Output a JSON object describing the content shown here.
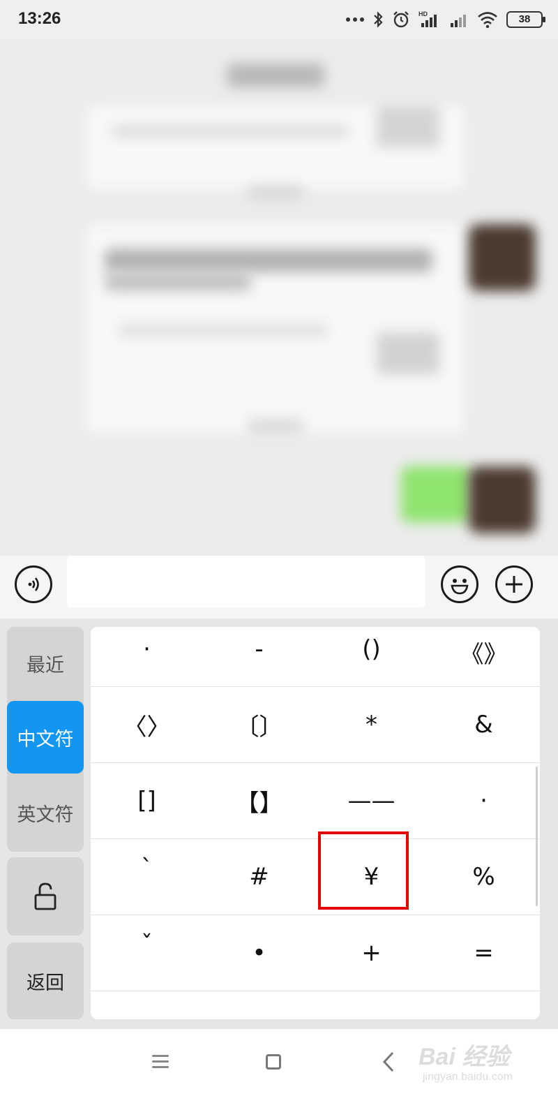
{
  "status_bar": {
    "time": "13:26",
    "battery": "38",
    "icons": [
      "more-dots-icon",
      "bluetooth-icon",
      "alarm-icon",
      "hd-signal-icon",
      "signal-icon",
      "wifi-icon",
      "battery-icon"
    ]
  },
  "input_bar": {
    "voice_icon": "voice-icon",
    "emoji_icon": "emoji-icon",
    "plus_icon": "plus-icon",
    "input_value": ""
  },
  "keyboard": {
    "categories": [
      {
        "label": "最近",
        "active": false
      },
      {
        "label": "中文符",
        "active": true
      },
      {
        "label": "英文符",
        "active": false
      }
    ],
    "lock_icon": "unlock-icon",
    "back_label": "返回",
    "accent_color": "#1296f2",
    "highlight_color": "#e60000",
    "highlighted_symbol": "¥",
    "rows": [
      [
        "·",
        "-",
        "()",
        "《》"
      ],
      [
        "〈〉",
        "〔〕",
        "*",
        "&"
      ],
      [
        "[]",
        "【】",
        "——",
        "·"
      ],
      [
        "`",
        "#",
        "¥",
        "%"
      ],
      [
        "ˇ",
        "•",
        "+",
        "="
      ]
    ]
  },
  "nav_bar": {
    "icons": [
      "menu-icon",
      "home-icon",
      "back-icon"
    ],
    "watermark_brand": "Bai 经验",
    "watermark_url": "jingyan.baidu.com"
  }
}
